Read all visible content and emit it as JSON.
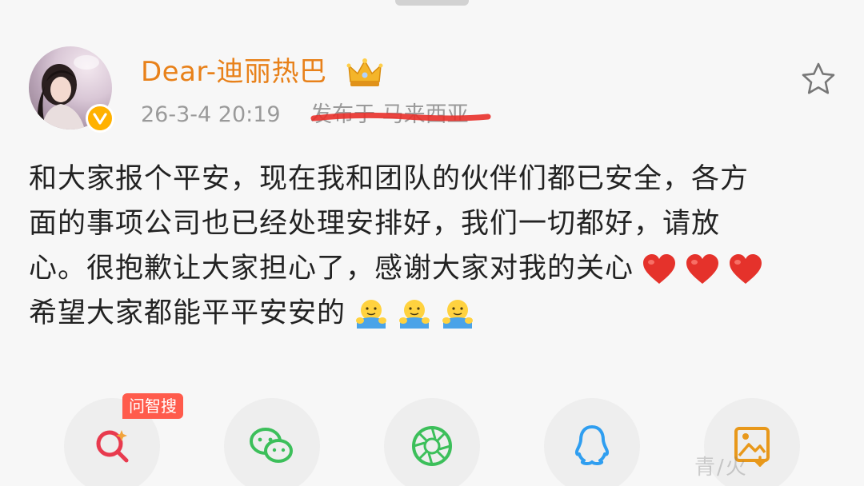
{
  "post": {
    "username": "Dear-迪丽热巴",
    "time": "26-3-4 20:19",
    "source": "发布于 马来西亚",
    "content_lines": [
      "和大家报个平安，现在我和团队的伙伴们都已安全，各方",
      "面的事项公司也已经处理安排好，我们一切都好，请放",
      "心。很抱歉让大家担心了，感谢大家对我的关心",
      "希望大家都能平平安安的"
    ],
    "colors": {
      "username": "#e8811a",
      "meta": "#9a9a9a",
      "strike": "#e8302a",
      "ai_tag": "#ff5b4c"
    }
  },
  "share_bar": {
    "ai_search_tag": "问智搜",
    "watermark": "青/火"
  },
  "icons": {
    "favorite": "star-outline-icon",
    "hearts": "red-heart-emoji",
    "hugs": "hug-emoji",
    "share": [
      "ai-search-icon",
      "wechat-icon",
      "moments-icon",
      "qq-icon",
      "save-image-icon"
    ]
  }
}
